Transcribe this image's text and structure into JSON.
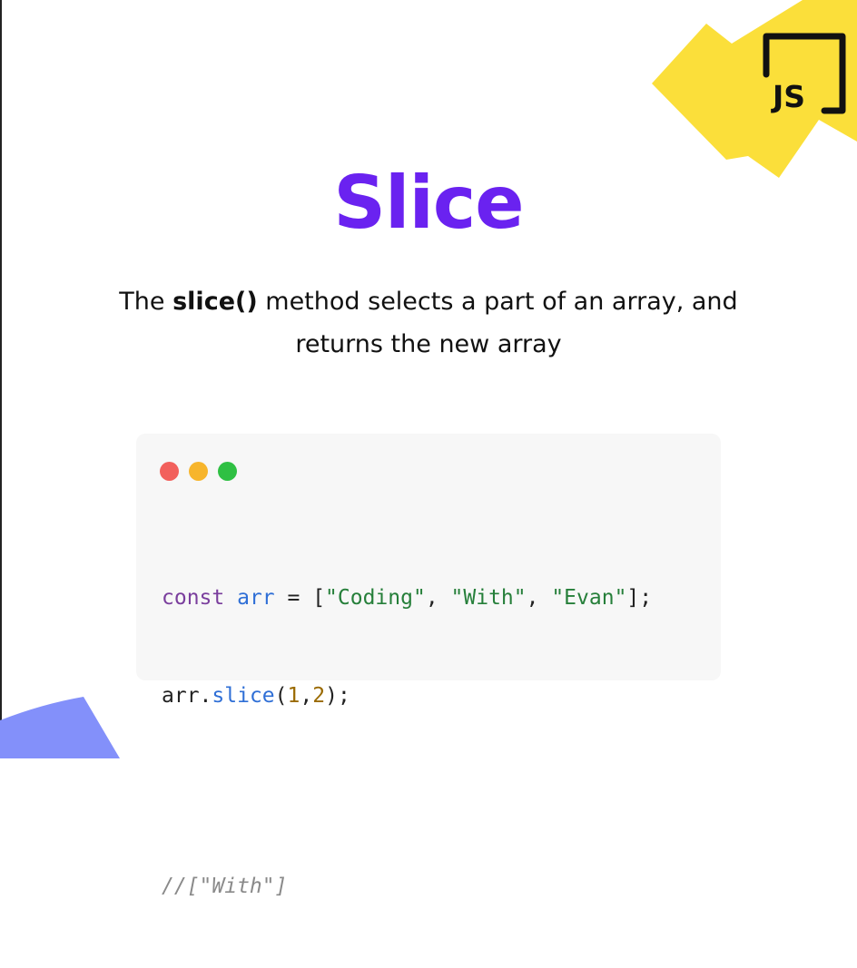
{
  "colors": {
    "title": "#6a22f0",
    "accent_yellow": "#fbdf3a",
    "accent_blue": "#8390fa",
    "dot_red": "#f2605c",
    "dot_yellow": "#f7b52c",
    "dot_green": "#2fc043"
  },
  "logo": {
    "text": "JS",
    "icon": "javascript-logo-icon"
  },
  "title": "Slice",
  "description": {
    "prefix": "The ",
    "method": "slice()",
    "suffix": " method selects a part of an array, and returns the new array"
  },
  "code_window": {
    "controls": [
      "close-dot-icon",
      "minimize-dot-icon",
      "maximize-dot-icon"
    ],
    "line1": {
      "keyword": "const",
      "variable": "arr",
      "op": " = [",
      "str1": "\"Coding\"",
      "sep1": ", ",
      "str2": "\"With\"",
      "sep2": ", ",
      "str3": "\"Evan\"",
      "end": "];"
    },
    "line2": {
      "object": "arr",
      "dot": ".",
      "method": "slice",
      "open": "(",
      "arg1": "1",
      "comma": ",",
      "arg2": "2",
      "close": ");"
    },
    "comment": "//[\"With\"]"
  }
}
